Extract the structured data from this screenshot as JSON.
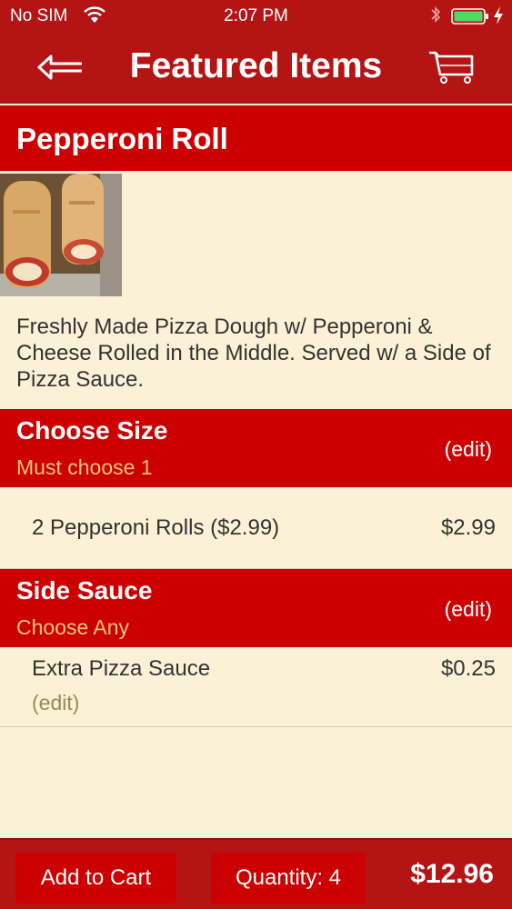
{
  "status_bar": {
    "carrier": "No SIM",
    "time": "2:07 PM",
    "icons": [
      "wifi-icon",
      "bluetooth-icon",
      "battery-icon",
      "charging-bolt-icon"
    ],
    "battery_color": "#4cd964"
  },
  "nav": {
    "title": "Featured Items",
    "back_icon": "back-arrow-icon",
    "cart_icon": "cart-icon"
  },
  "colors": {
    "nav_bg": "#b51414",
    "header_bg": "#cc0000",
    "page_bg": "#fbf1d6",
    "subtitle": "#f6c27a",
    "edit_link": "#9a8a55"
  },
  "product": {
    "name": "Pepperoni Roll",
    "description": "Freshly Made Pizza Dough w/ Pepperoni & Cheese Rolled in the Middle. Served  w/ a Side of Pizza Sauce."
  },
  "sections": [
    {
      "title": "Choose Size",
      "subtitle": "Must choose 1",
      "edit_label": "(edit)",
      "options": [
        {
          "name": "2 Pepperoni Rolls ($2.99)",
          "price": "$2.99"
        }
      ]
    },
    {
      "title": "Side Sauce",
      "subtitle": "Choose Any",
      "edit_label": "(edit)",
      "options": [
        {
          "name": "Extra Pizza Sauce",
          "price": "$0.25",
          "edit_label": "(edit)"
        }
      ]
    }
  ],
  "bottom_bar": {
    "add_to_cart_label": "Add to Cart",
    "quantity_label": "Quantity: 4",
    "total": "$12.96"
  }
}
